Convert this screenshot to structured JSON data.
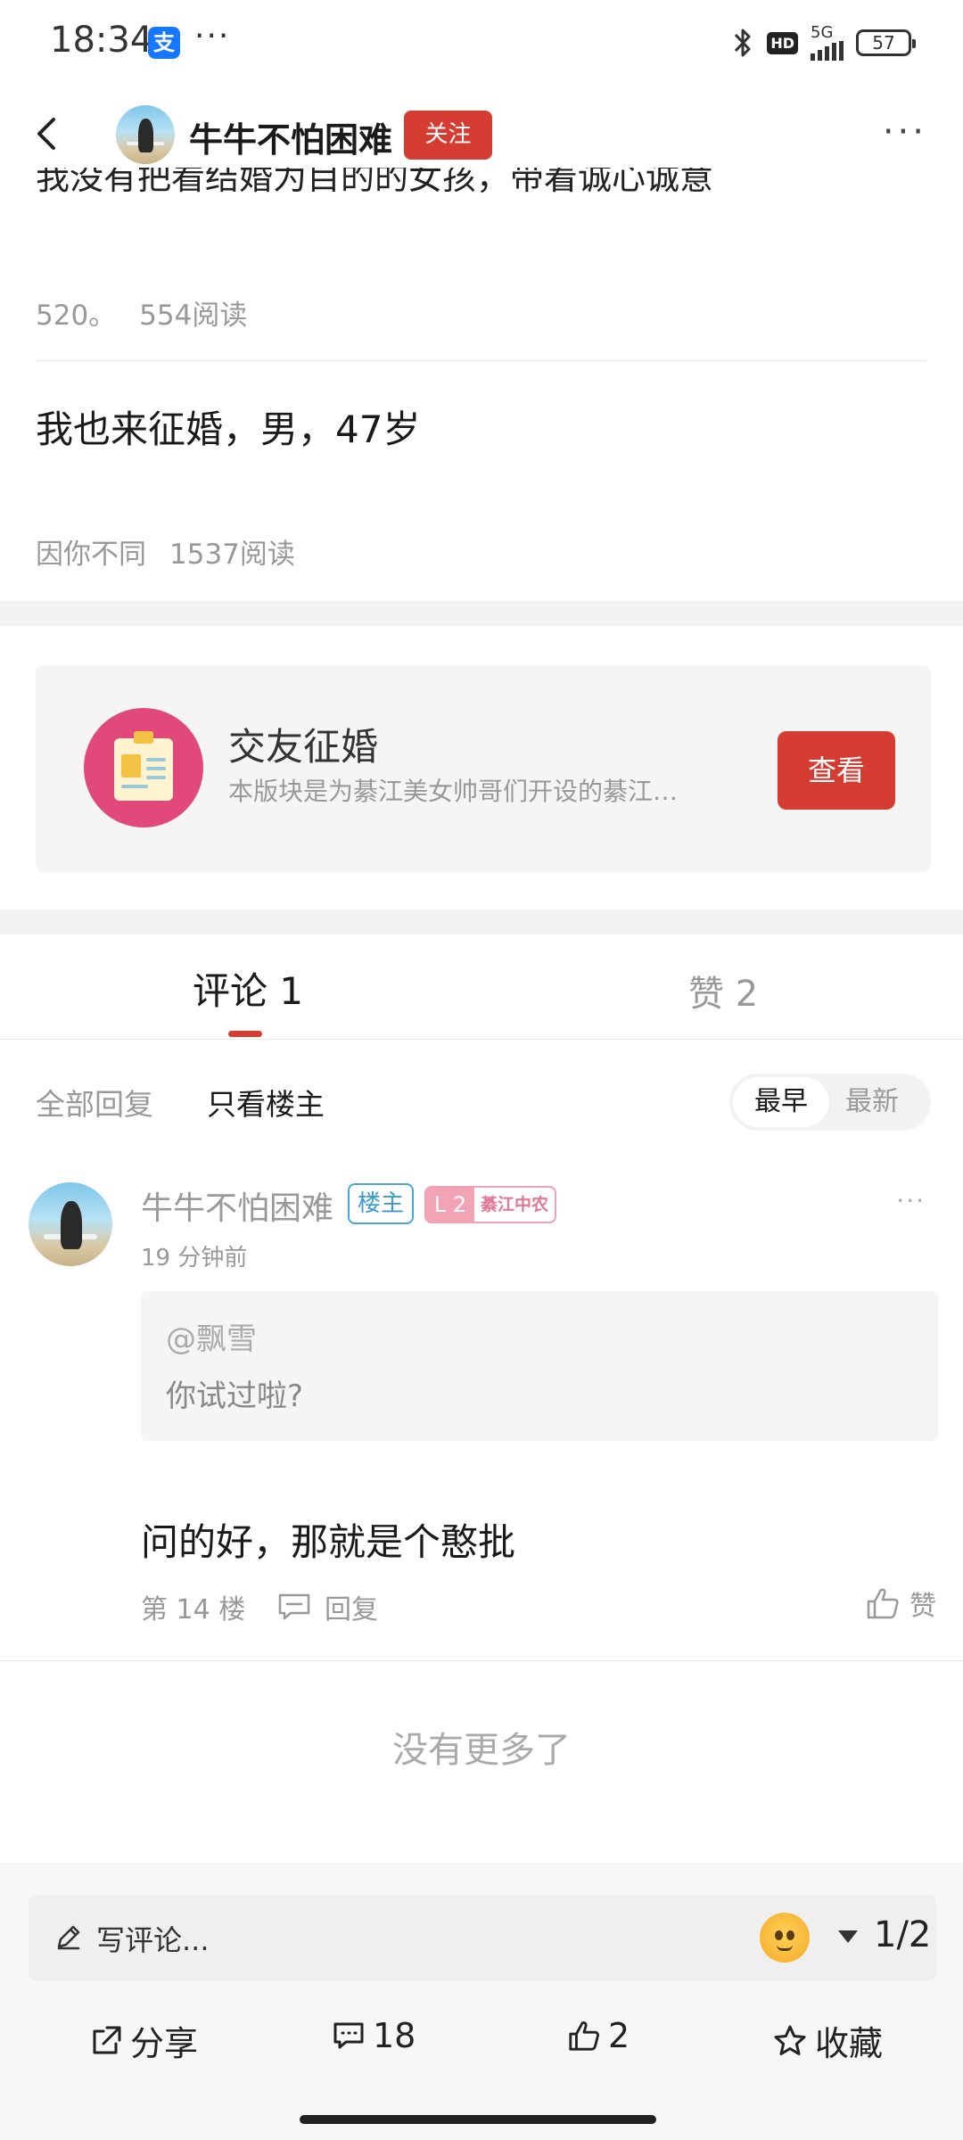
{
  "status_bar": {
    "time": "18:34",
    "alipay_glyph": "支",
    "dots": "···",
    "hd": "HD",
    "network": "5G",
    "battery": "57"
  },
  "nav": {
    "title": "牛牛不怕困难",
    "follow_label": "关注"
  },
  "feed": {
    "partial_post_text": "我没有把看结婚为目的的女孩，带着诚心诚意",
    "posts": [
      {
        "author": "520。",
        "reads": "554阅读"
      },
      {
        "title": "我也来征婚，男，47岁",
        "author": "因你不同",
        "reads": "1537阅读"
      }
    ]
  },
  "forum_card": {
    "name": "交友征婚",
    "description": "本版块是为綦江美女帅哥们开设的綦江…",
    "view_label": "查看"
  },
  "tabs": {
    "comments": "评论 1",
    "likes": "赞 2"
  },
  "filters": {
    "all": "全部回复",
    "owner_only": "只看楼主",
    "sort_early": "最早",
    "sort_new": "最新"
  },
  "comment": {
    "author": "牛牛不怕困难",
    "owner_badge": "楼主",
    "level": "L 2",
    "group_badge": "綦江中农",
    "time": "19 分钟前",
    "quote_user": "@飘雪",
    "quote_text": "你试过啦?",
    "body": "问的好，那就是个憨批",
    "floor": "第 14 楼",
    "reply_label": "回复",
    "like_label": "赞"
  },
  "no_more": "没有更多了",
  "bottom_bar": {
    "input_placeholder": "写评论...",
    "page_indicator": "1/2",
    "share": "分享",
    "comments_count": "18",
    "likes_count": "2",
    "favorite": "收藏"
  },
  "colors": {
    "accent": "#d53d33",
    "owner_badge": "#3a9bd0",
    "level_badge": "#f3a3b6"
  }
}
